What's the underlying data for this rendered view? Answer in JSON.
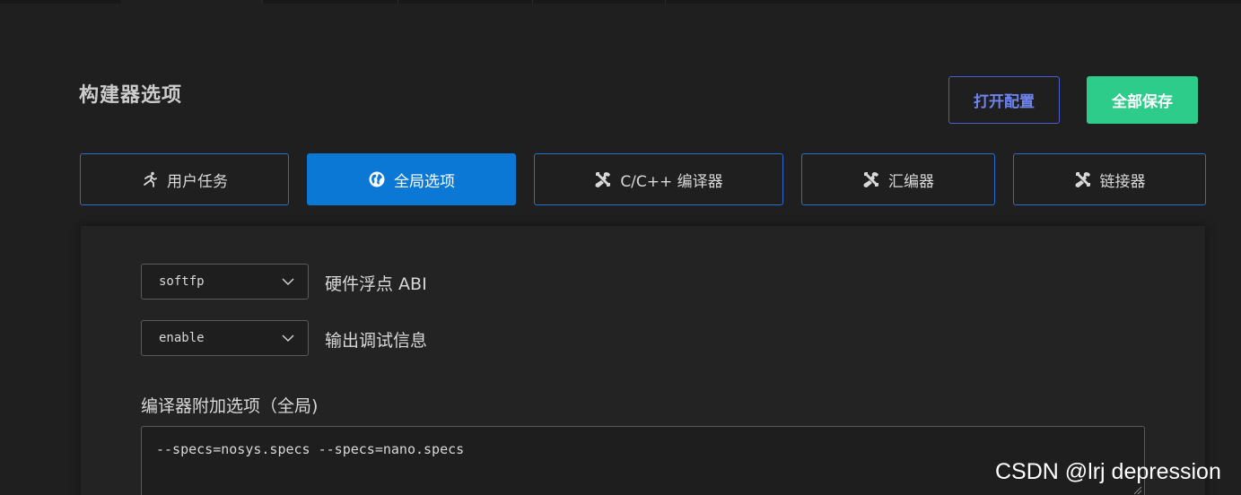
{
  "page": {
    "title": "构建器选项"
  },
  "actions": {
    "open_config": "打开配置",
    "save_all": "全部保存"
  },
  "tabs": [
    {
      "label": "用户任务",
      "icon": "running-person-icon",
      "active": false
    },
    {
      "label": "全局选项",
      "icon": "globe-icon",
      "active": true
    },
    {
      "label": "C/C++ 编译器",
      "icon": "tools-icon",
      "active": false
    },
    {
      "label": "汇编器",
      "icon": "tools-icon",
      "active": false
    },
    {
      "label": "链接器",
      "icon": "tools-icon",
      "active": false
    }
  ],
  "options": {
    "float_abi": {
      "value": "softfp",
      "label": "硬件浮点 ABI"
    },
    "debug_info": {
      "value": "enable",
      "label": "输出调试信息"
    }
  },
  "compiler_extra": {
    "label": "编译器附加选项（全局)",
    "value": "--specs=nosys.specs --specs=nano.specs"
  },
  "watermark": "CSDN @lrj  depression",
  "colors": {
    "background": "#1f1f1f",
    "accent_blue": "#0b78d6",
    "save_green": "#2ecc8a",
    "open_border": "#4a5fd6"
  }
}
